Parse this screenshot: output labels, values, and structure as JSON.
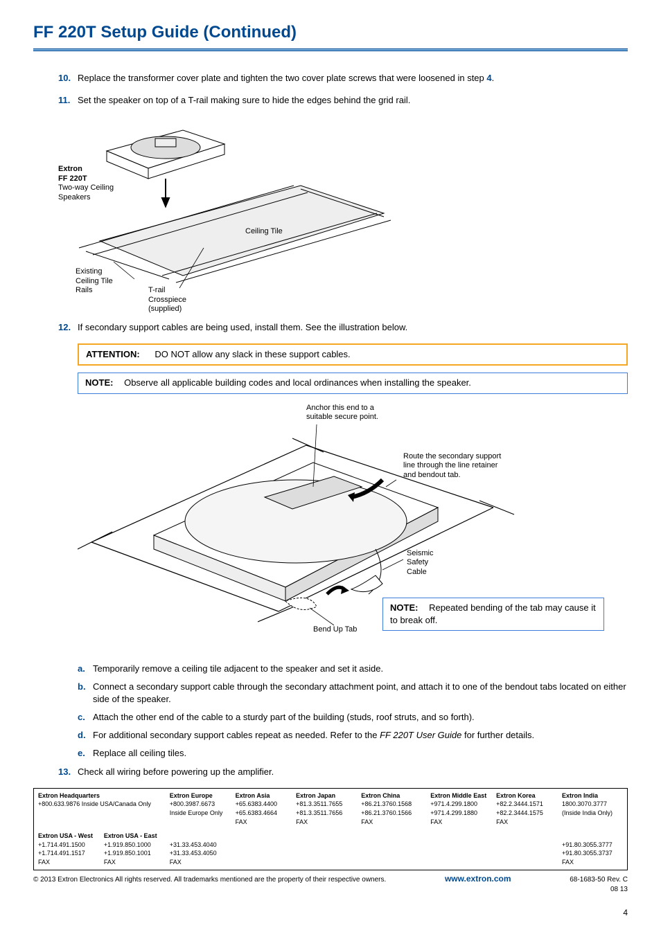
{
  "title": "FF 220T Setup Guide (Continued)",
  "steps": {
    "s10": {
      "num": "10.",
      "text": "Replace the transformer cover plate and tighten the two cover plate screws that were loosened in step ",
      "ref": "4",
      "tail": "."
    },
    "s11": {
      "num": "11.",
      "text": "Set the speaker on top of a T-rail making sure to hide the edges behind the grid rail."
    },
    "s12": {
      "num": "12.",
      "text": "If secondary support cables are being used, install them.  See the illustration below."
    },
    "s13": {
      "num": "13.",
      "text": "Check all wiring before powering up the amplifier."
    }
  },
  "fig1": {
    "product_bold1": "Extron",
    "product_bold2": "FF 220T",
    "product_sub": "Two-way Ceiling\nSpeakers",
    "ceiling_tile": "Ceiling Tile",
    "rails": "Existing\nCeiling Tile\nRails",
    "trail": "T-rail\nCrosspiece\n(supplied)"
  },
  "attention": {
    "label": "ATTENTION:",
    "text": "DO NOT allow any slack in these support cables."
  },
  "note1": {
    "label": "NOTE:",
    "text": "Observe all applicable building codes and local ordinances when installing the speaker."
  },
  "fig2": {
    "anchor": "Anchor this end to a\nsuitable secure point.",
    "route": "Route the secondary support\nline through the line retainer\nand bendout tab.",
    "seismic": "Seismic\nSafety\nCable",
    "bend": "Bend Up Tab"
  },
  "inline_note": {
    "label": "NOTE:",
    "text": "Repeated bending of the tab may cause it to break off."
  },
  "subs": {
    "a": {
      "num": "a.",
      "text": "Temporarily remove a ceiling tile adjacent to the speaker and set it aside."
    },
    "b": {
      "num": "b.",
      "text": "Connect a secondary support cable through the secondary attachment point, and attach it to one of the bendout tabs located on either side of the speaker."
    },
    "c": {
      "num": "c.",
      "text": "Attach the other end of the cable to a sturdy part of the building (studs, roof struts, and so forth)."
    },
    "d": {
      "num": "d.",
      "pre": "For additional secondary support cables repeat as needed. Refer to the ",
      "italic": "FF 220T User Guide",
      "post": " for further details."
    },
    "e": {
      "num": "e.",
      "text": "Replace all ceiling tiles."
    }
  },
  "contacts": [
    {
      "name": "Extron Headquarters",
      "l1": "+800.633.9876 Inside USA/Canada Only",
      "l2": "",
      "l3": ""
    },
    {
      "name": "Extron Europe",
      "l1": "+800.3987.6673",
      "l2": "Inside Europe Only",
      "l3": ""
    },
    {
      "name": "Extron Asia",
      "l1": "+65.6383.4400",
      "l2": "+65.6383.4664 FAX",
      "l3": ""
    },
    {
      "name": "Extron Japan",
      "l1": "+81.3.3511.7655",
      "l2": "+81.3.3511.7656 FAX",
      "l3": ""
    },
    {
      "name": "Extron China",
      "l1": "+86.21.3760.1568",
      "l2": "+86.21.3760.1566 FAX",
      "l3": ""
    },
    {
      "name": "Extron Middle East",
      "l1": "+971.4.299.1800",
      "l2": "+971.4.299.1880 FAX",
      "l3": ""
    },
    {
      "name": "Extron Korea",
      "l1": "+82.2.3444.1571",
      "l2": "+82.2.3444.1575 FAX",
      "l3": ""
    },
    {
      "name": "Extron India",
      "l1": "1800.3070.3777",
      "l2": "(Inside India Only)",
      "l3": ""
    }
  ],
  "contacts_row2": {
    "west": {
      "name": "Extron USA - West",
      "l1": "+1.714.491.1500",
      "l2": "+1.714.491.1517 FAX"
    },
    "east": {
      "name": "Extron USA - East",
      "l1": "+1.919.850.1000",
      "l2": "+1.919.850.1001 FAX"
    },
    "eu": {
      "l1": "+31.33.453.4040",
      "l2": "+31.33.453.4050 FAX"
    },
    "india": {
      "l1": "+91.80.3055.3777",
      "l2": "+91.80.3055.3737 FAX"
    }
  },
  "footer": {
    "copyright": "© 2013 Extron Electronics   All rights reserved.  All trademarks mentioned are the property of their respective owners.",
    "url": "www.extron.com",
    "doc": "68-1683-50  Rev. C",
    "date": "08 13"
  },
  "page_num": "4"
}
